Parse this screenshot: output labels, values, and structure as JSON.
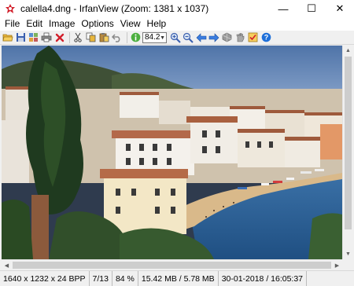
{
  "window": {
    "title": "calella4.dng - IrfanView (Zoom: 1381 x 1037)",
    "minimize_glyph": "—",
    "maximize_glyph": "☐",
    "close_glyph": "✕"
  },
  "menu": {
    "items": [
      {
        "label": "File"
      },
      {
        "label": "Edit"
      },
      {
        "label": "Image"
      },
      {
        "label": "Options"
      },
      {
        "label": "View"
      },
      {
        "label": "Help"
      }
    ]
  },
  "toolbar": {
    "zoom_value": "84.2",
    "icons": [
      "open-folder-icon",
      "save-icon",
      "thumbnails-icon",
      "print-icon",
      "delete-icon",
      "cut-icon",
      "copy-icon",
      "paste-icon",
      "undo-icon",
      "info-icon",
      "zoom-in-icon",
      "zoom-out-icon",
      "previous-icon",
      "next-icon",
      "slideshow-icon",
      "slideshow-hand-icon",
      "settings-icon",
      "help-icon"
    ]
  },
  "colors": {
    "sky": "#6d8fbf",
    "sea": "#2c5c93",
    "accent_red": "#d21f2b",
    "help_blue": "#1e6fd9"
  },
  "status": {
    "dimensions": "1640 x 1232 x 24 BPP",
    "page": "7/13",
    "zoom": "84 %",
    "size": "15.42 MB / 5.78 MB",
    "datetime": "30-01-2018 / 16:05:37"
  }
}
